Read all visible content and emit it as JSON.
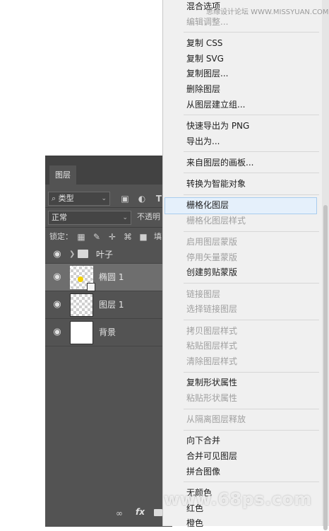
{
  "layers_panel": {
    "tab_label": "图层",
    "filter": {
      "icon": "search-icon",
      "label": "类型"
    },
    "blend_mode": "正常",
    "opacity_label": "不透明",
    "lock_label": "锁定：",
    "fill_label": "填",
    "group": {
      "name": "叶子"
    },
    "layers": [
      {
        "name": "椭圆 1",
        "selected": true,
        "thumb": "shape"
      },
      {
        "name": "图层 1",
        "selected": false,
        "thumb": "transparent"
      },
      {
        "name": "背景",
        "selected": false,
        "thumb": "white"
      }
    ],
    "bottom_icons": [
      "link-icon",
      "fx-icon",
      "mask-icon"
    ],
    "fx_label": "fx"
  },
  "context_menu": {
    "items": [
      {
        "label": "混合选项",
        "disabled": false
      },
      {
        "label": "编辑调整...",
        "disabled": true
      },
      {
        "separator": true
      },
      {
        "label": "复制 CSS",
        "disabled": false
      },
      {
        "label": "复制 SVG",
        "disabled": false
      },
      {
        "label": "复制图层...",
        "disabled": false
      },
      {
        "label": "删除图层",
        "disabled": false
      },
      {
        "label": "从图层建立组...",
        "disabled": false
      },
      {
        "separator": true
      },
      {
        "label": "快速导出为 PNG",
        "disabled": false
      },
      {
        "label": "导出为...",
        "disabled": false
      },
      {
        "separator": true
      },
      {
        "label": "来自图层的画板...",
        "disabled": false
      },
      {
        "separator": true
      },
      {
        "label": "转换为智能对象",
        "disabled": false
      },
      {
        "separator": true
      },
      {
        "label": "栅格化图层",
        "disabled": false,
        "highlighted": true
      },
      {
        "label": "栅格化图层样式",
        "disabled": true
      },
      {
        "separator": true
      },
      {
        "label": "启用图层蒙版",
        "disabled": true
      },
      {
        "label": "停用矢量蒙版",
        "disabled": true
      },
      {
        "label": "创建剪贴蒙版",
        "disabled": false
      },
      {
        "separator": true
      },
      {
        "label": "链接图层",
        "disabled": true
      },
      {
        "label": "选择链接图层",
        "disabled": true
      },
      {
        "separator": true
      },
      {
        "label": "拷贝图层样式",
        "disabled": true
      },
      {
        "label": "粘贴图层样式",
        "disabled": true
      },
      {
        "label": "清除图层样式",
        "disabled": true
      },
      {
        "separator": true
      },
      {
        "label": "复制形状属性",
        "disabled": false
      },
      {
        "label": "粘贴形状属性",
        "disabled": true
      },
      {
        "separator": true
      },
      {
        "label": "从隔离图层释放",
        "disabled": true
      },
      {
        "separator": true
      },
      {
        "label": "向下合并",
        "disabled": false
      },
      {
        "label": "合并可见图层",
        "disabled": false
      },
      {
        "label": "拼合图像",
        "disabled": false
      },
      {
        "separator": true
      },
      {
        "label": "无颜色",
        "disabled": false
      },
      {
        "label": "红色",
        "disabled": false
      },
      {
        "label": "橙色",
        "disabled": false
      }
    ]
  },
  "watermarks": {
    "top": "思缘设计论坛  WWW.MISSYUAN.COM",
    "bottom": "www.68ps.com"
  },
  "colors": {
    "panel_bg": "#535353",
    "menu_bg": "#f0f0f0",
    "highlight": "#e5f0fb",
    "disabled_text": "#a0a0a0"
  }
}
